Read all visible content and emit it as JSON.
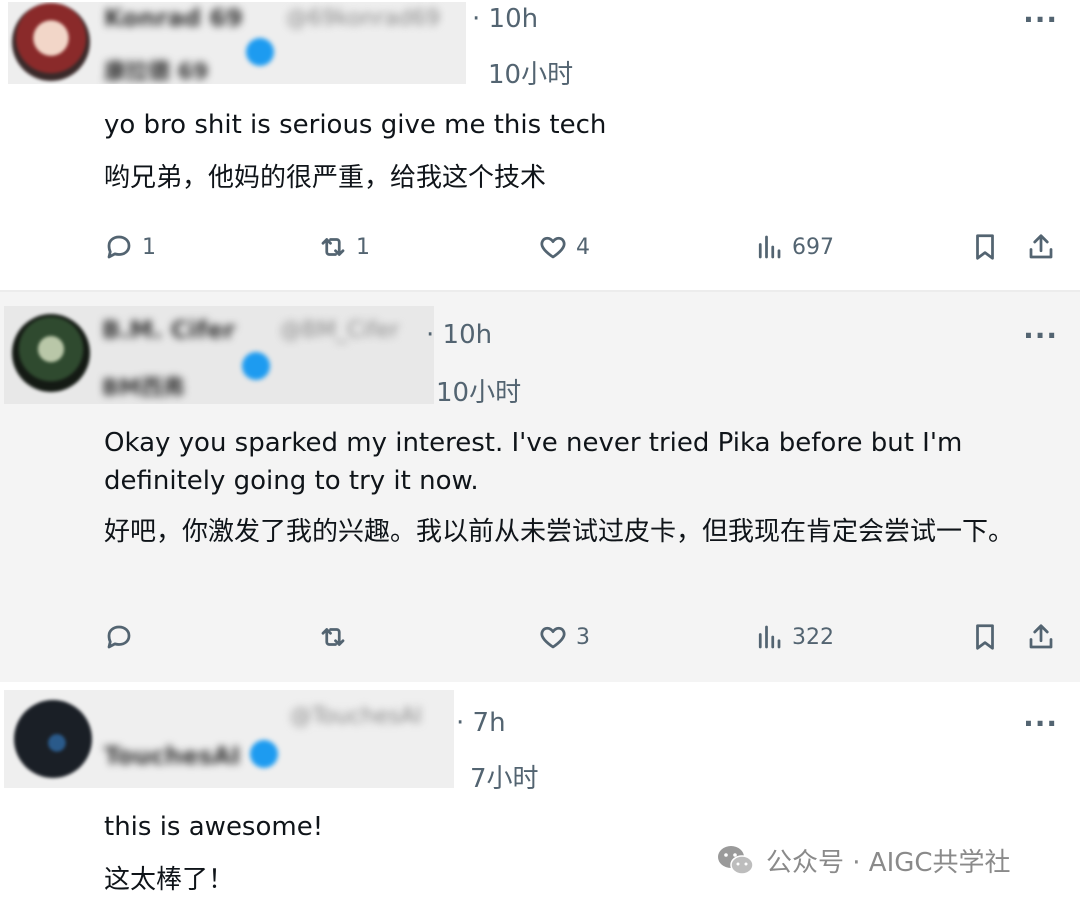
{
  "posts": [
    {
      "author_name": "Konrad 69",
      "handle": "@69konrad69",
      "cn_name": "康拉德 69",
      "time": "· 10h",
      "time_cn": "10小时",
      "text_en": "yo bro shit is serious give me this tech",
      "text_zh": "哟兄弟，他妈的很严重，给我这个技术",
      "replies": "1",
      "reposts": "1",
      "likes": "4",
      "views": "697"
    },
    {
      "author_name": "B.M. Cifer",
      "handle": "@BM_Cifer",
      "cn_name": "BM西弗",
      "time": "· 10h",
      "time_cn": "10小时",
      "text_en": "Okay you sparked my interest. I've never tried Pika before but I'm definitely going to try it now.",
      "text_zh": "好吧，你激发了我的兴趣。我以前从未尝试过皮卡，但我现在肯定会尝试一下。",
      "replies": "",
      "reposts": "",
      "likes": "3",
      "views": "322"
    },
    {
      "author_name": "TouchesAI",
      "handle": "@TouchesAI",
      "time": "· 7h",
      "time_cn": "7小时",
      "text_en": "this is awesome!",
      "text_zh": "这太棒了！"
    }
  ],
  "more_label": "···",
  "watermark": {
    "text": "公众号 · AIGC共学社",
    "icon": "wechat-icon"
  },
  "icons": [
    "reply-icon",
    "repost-icon",
    "like-icon",
    "views-icon",
    "bookmark-icon",
    "share-icon",
    "more-icon",
    "verified-icon"
  ],
  "colors": {
    "muted": "#536471",
    "text": "#0f1419",
    "verified": "#1d9bf0",
    "highlight_bg": "#f4f4f4"
  }
}
